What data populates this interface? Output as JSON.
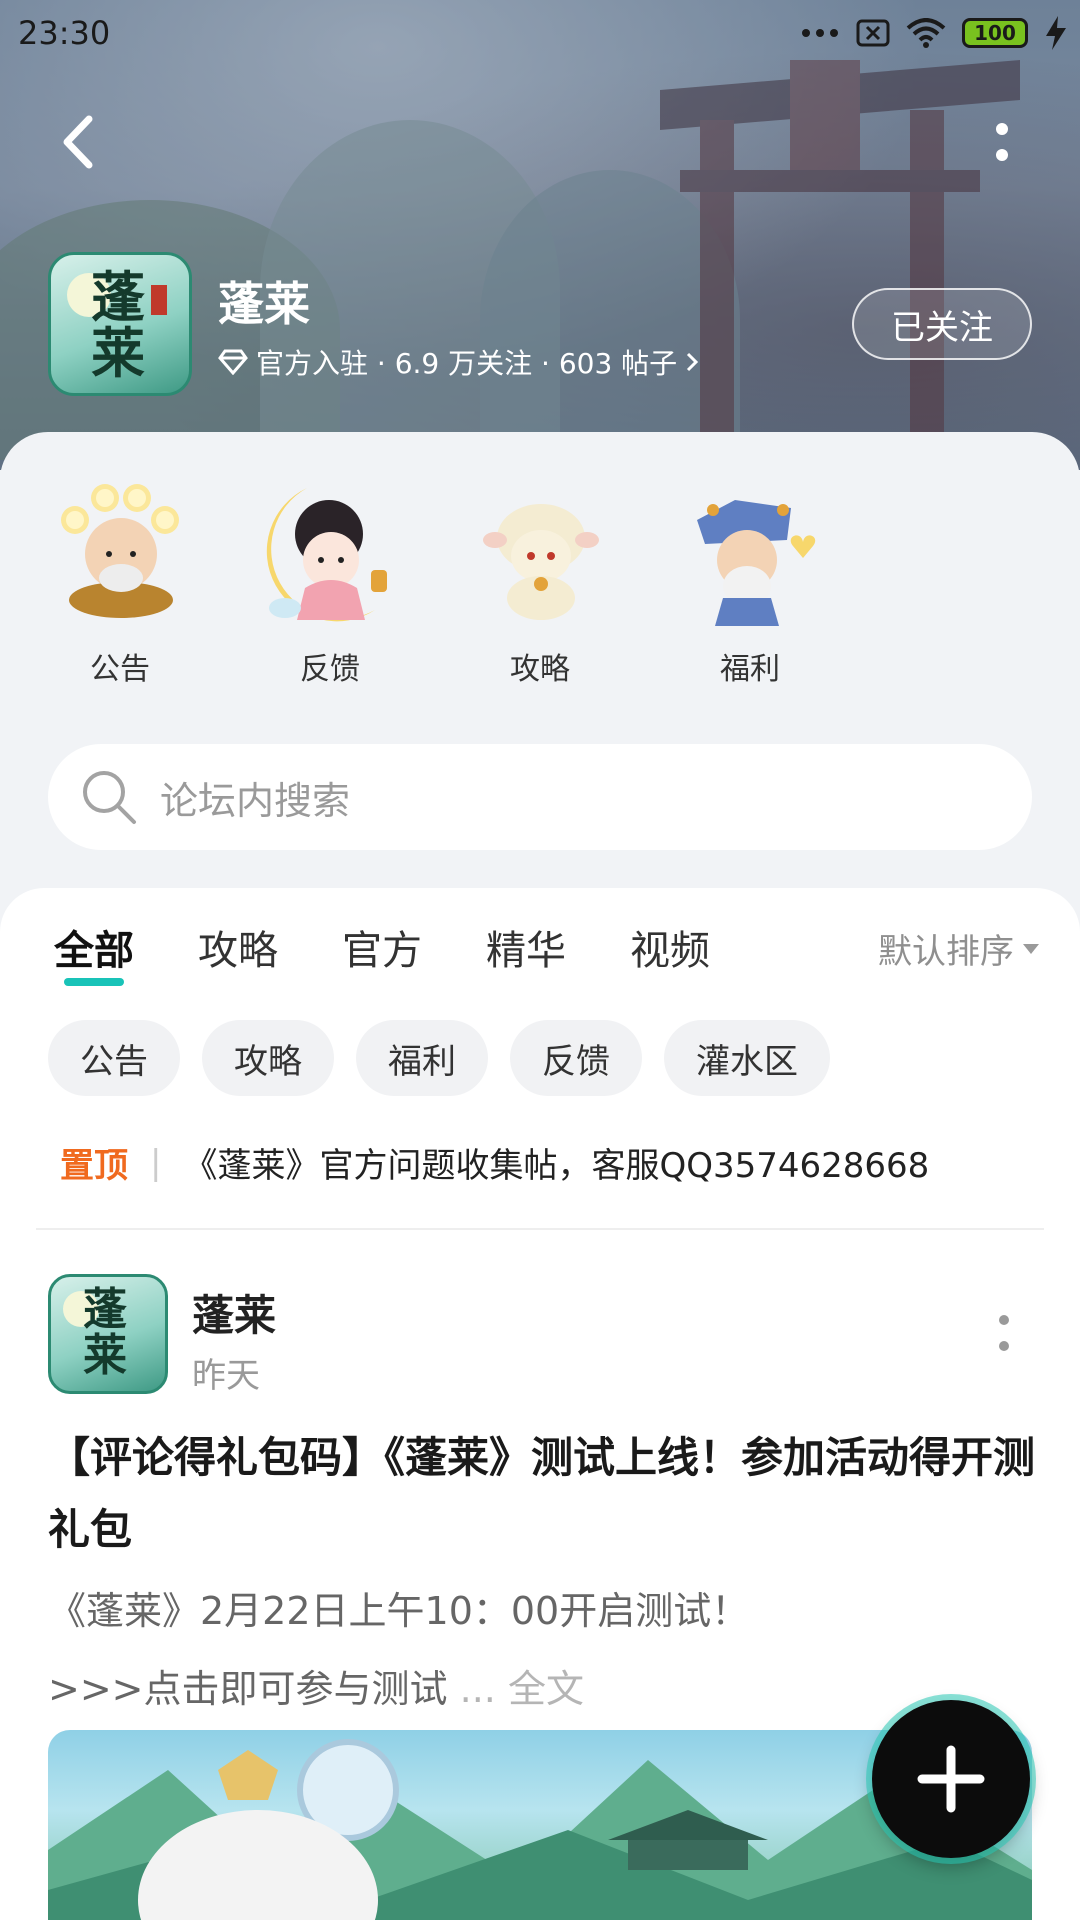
{
  "status_bar": {
    "time": "23:30",
    "battery": "100"
  },
  "forum": {
    "logo_text": "蓬莱",
    "name": "蓬莱",
    "meta": "官方入驻 · 6.9 万关注 · 603 帖子",
    "follow_label": "已关注"
  },
  "shortcuts": [
    {
      "label": "公告",
      "icon": "monk-character-icon"
    },
    {
      "label": "反馈",
      "icon": "moon-maiden-character-icon"
    },
    {
      "label": "攻略",
      "icon": "sheep-character-icon"
    },
    {
      "label": "福利",
      "icon": "elder-sage-character-icon"
    }
  ],
  "search": {
    "placeholder": "论坛内搜索"
  },
  "tabs": [
    {
      "label": "全部",
      "active": true
    },
    {
      "label": "攻略",
      "active": false
    },
    {
      "label": "官方",
      "active": false
    },
    {
      "label": "精华",
      "active": false
    },
    {
      "label": "视频",
      "active": false
    }
  ],
  "sort_label": "默认排序",
  "chips": [
    "公告",
    "攻略",
    "福利",
    "反馈",
    "灌水区"
  ],
  "pinned": {
    "tag": "置顶",
    "text": "《蓬莱》官方问题收集帖，客服QQ3574628668"
  },
  "post": {
    "author": "蓬莱",
    "time": "昨天",
    "title": "【评论得礼包码】《蓬莱》测试上线！参加活动得开测礼包",
    "body_line1": "《蓬莱》2月22日上午10：00开启测试！",
    "body_line2": ">>>点击即可参与测试",
    "more_label": "... 全文"
  },
  "colors": {
    "accent": "#19c3b8",
    "pinned": "#f06a1f"
  }
}
